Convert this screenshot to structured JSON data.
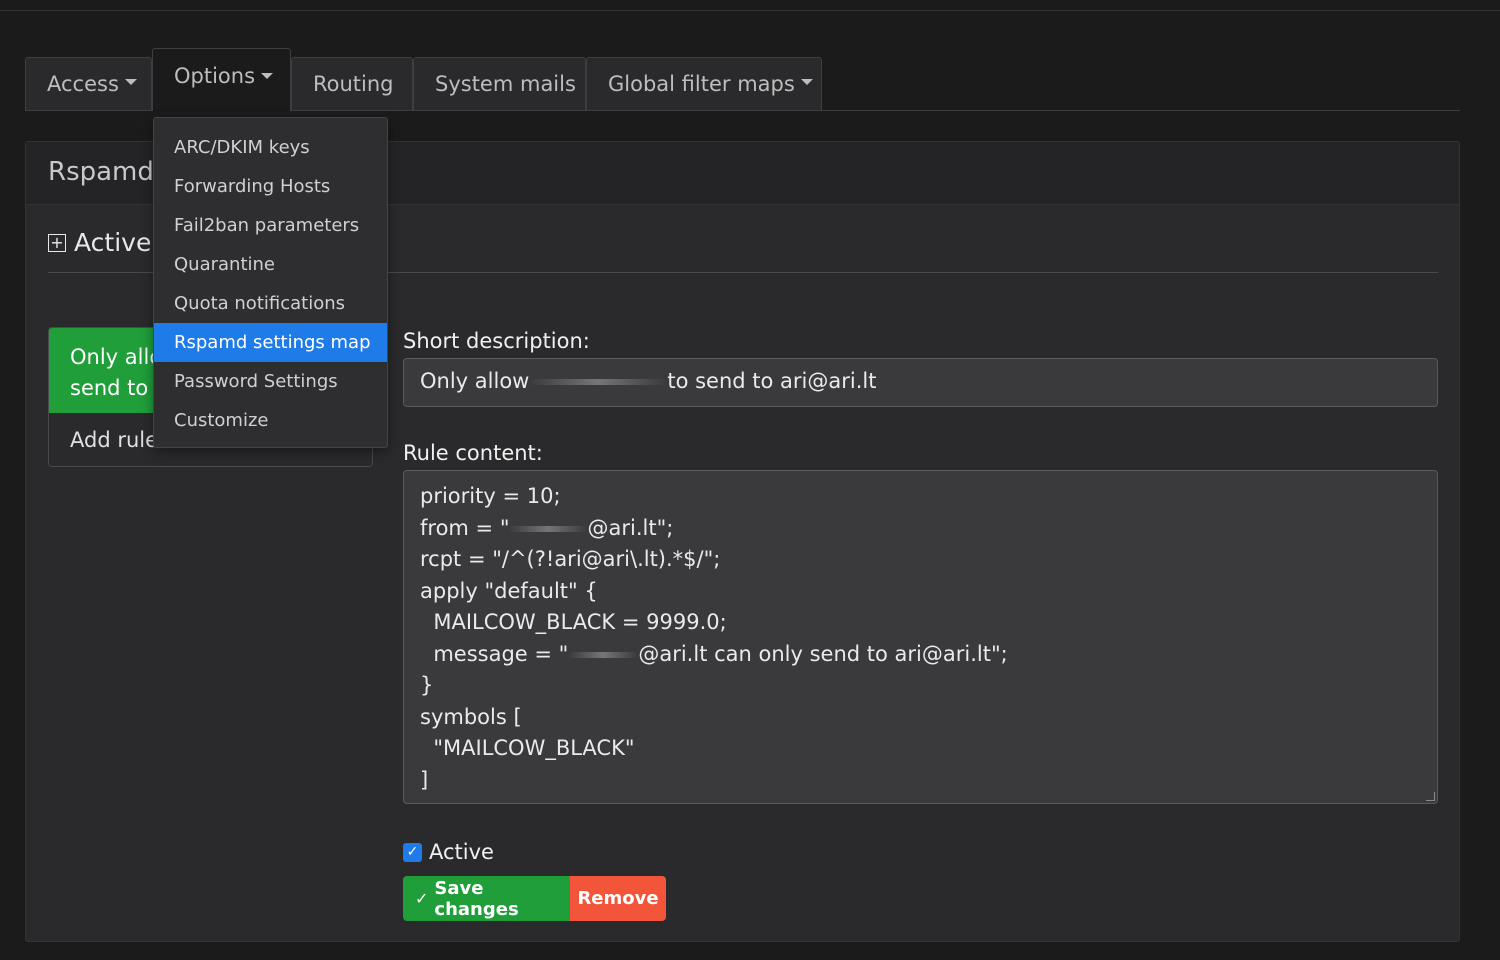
{
  "tabs": [
    {
      "label": "Access",
      "has_caret": true
    },
    {
      "label": "Options",
      "has_caret": true
    },
    {
      "label": "Routing",
      "has_caret": false
    },
    {
      "label": "System mails",
      "has_caret": false
    },
    {
      "label": "Global filter maps",
      "has_caret": true
    }
  ],
  "panel": {
    "title": "Rspamd",
    "section_heading": "Active",
    "list": {
      "selected_item": "Only allow",
      "selected_item_line2": "send to a",
      "add_rule": "Add rule"
    }
  },
  "dropdown": {
    "items": [
      "ARC/DKIM keys",
      "Forwarding Hosts",
      "Fail2ban parameters",
      "Quarantine",
      "Quota notifications",
      "Rspamd settings map",
      "Password Settings",
      "Customize"
    ],
    "highlighted": "Rspamd settings map"
  },
  "form": {
    "short_description_label": "Short description:",
    "short_description_prefix": "Only allow",
    "short_description_suffix": "to send to ari@ari.lt",
    "rule_content_label": "Rule content:",
    "rule_lines": [
      "priority = 10;",
      "from = \"",
      "@ari.lt\";",
      "rcpt = \"/^(?!ari@ari\\.lt).*$/\";",
      "apply \"default\" {",
      "  MAILCOW_BLACK = 9999.0;",
      "  message = \"",
      "@ari.lt can only send to ari@ari.lt\";",
      "}",
      "symbols [",
      "  \"MAILCOW_BLACK\"",
      "]"
    ],
    "active_label": "Active",
    "active_checked": true,
    "save_label": "Save changes",
    "remove_label": "Remove"
  },
  "colors": {
    "success": "#1f9e3a",
    "danger": "#f3553a",
    "primary": "#1e7be8"
  }
}
